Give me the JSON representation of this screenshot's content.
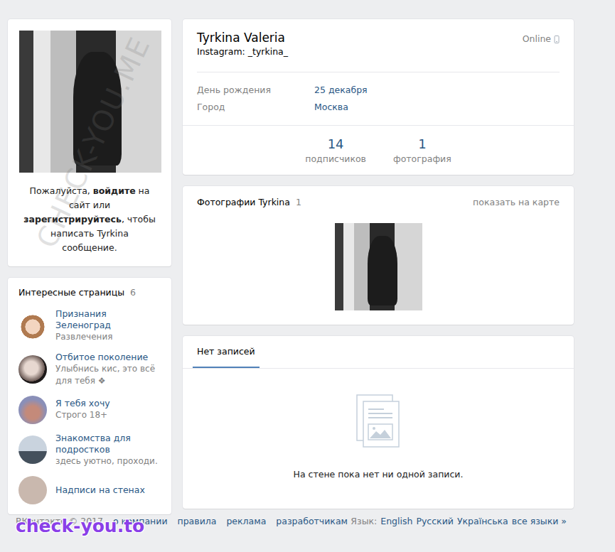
{
  "sidebar": {
    "login_prompt": [
      {
        "text": "Пожалуйста, ",
        "kind": "plain"
      },
      {
        "text": "войдите",
        "kind": "bold"
      },
      {
        "text": " на сайт или ",
        "kind": "plain"
      },
      {
        "text": "зарегистрируйтесь",
        "kind": "bold"
      },
      {
        "text": ", чтобы написать Tyrkina сообщение.",
        "kind": "plain"
      }
    ],
    "interesting_pages": {
      "title": "Интересные страницы",
      "count": "6",
      "items": [
        {
          "name": "Признания Зеленоград",
          "subtitle": "Развлечения"
        },
        {
          "name": "Отбитое поколение",
          "subtitle": "Улыбнись кис, это всё для тебя ❖"
        },
        {
          "name": "Я тебя хочу",
          "subtitle": "Строго 18+"
        },
        {
          "name": "Знакомства для подростков",
          "subtitle": "здесь уютно, проходи."
        },
        {
          "name": "Надписи на стенах",
          "subtitle": ""
        }
      ]
    }
  },
  "profile": {
    "name": "Tyrkina Valeria",
    "status": "Instagram: _tyrkina_",
    "online": "Online",
    "info": [
      {
        "label": "День рождения",
        "value": "25 декабря"
      },
      {
        "label": "Город",
        "value": "Москва"
      }
    ],
    "counters": [
      {
        "value": "14",
        "label": "подписчиков"
      },
      {
        "value": "1",
        "label": "фотография"
      }
    ]
  },
  "photos": {
    "title": "Фотографии Tyrkina",
    "count": "1",
    "map_link": "показать на карте"
  },
  "wall": {
    "tabs": [
      {
        "label": "Нет записей",
        "selected": true
      }
    ],
    "empty_text": "На стене пока нет ни одной записи."
  },
  "footer": {
    "copyright": "ВКонтакте © 2017",
    "links": [
      "о компании",
      "правила",
      "реклама",
      "разработчикам"
    ],
    "language_label": "Язык:",
    "languages": [
      "English",
      "Русский",
      "Українська",
      "все языки »"
    ]
  },
  "watermarks": {
    "faint": "CHECK-YOU.ME",
    "logo": "check-you.to"
  }
}
